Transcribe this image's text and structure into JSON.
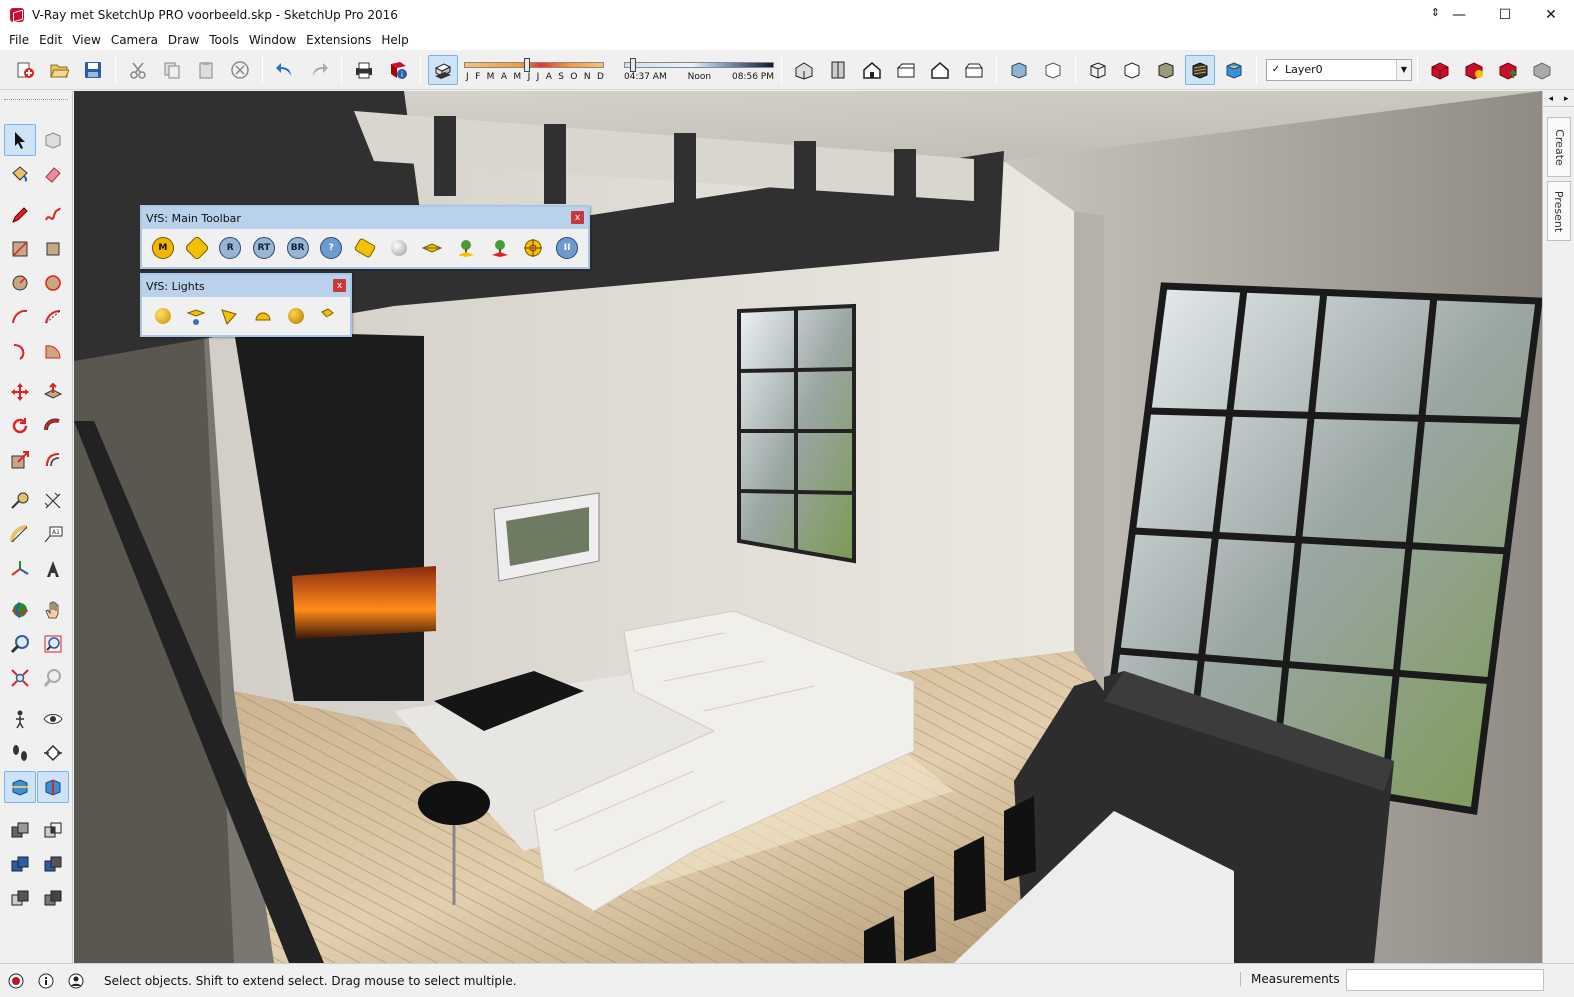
{
  "window": {
    "title": "V-Ray met SketchUp PRO voorbeeld.skp - SketchUp Pro 2016",
    "minimize": "—",
    "maximize": "☐",
    "close": "✕"
  },
  "menu": [
    "File",
    "Edit",
    "View",
    "Camera",
    "Draw",
    "Tools",
    "Window",
    "Extensions",
    "Help"
  ],
  "shadows": {
    "months": [
      "J",
      "F",
      "M",
      "A",
      "M",
      "J",
      "J",
      "A",
      "S",
      "O",
      "N",
      "D"
    ],
    "month_position": 0.44,
    "time_start": "04:37 AM",
    "time_mid": "Noon",
    "time_end": "08:56 PM",
    "time_position": 0.04
  },
  "layer": {
    "check": "✓",
    "current": "Layer0"
  },
  "float_main": {
    "title": "VfS: Main Toolbar",
    "close": "x",
    "buttons": [
      {
        "name": "vray-material-editor",
        "glyph": "M"
      },
      {
        "name": "vray-options",
        "glyph": ""
      },
      {
        "name": "vray-render",
        "glyph": "R"
      },
      {
        "name": "vray-render-rt",
        "glyph": "RT"
      },
      {
        "name": "vray-batch-render",
        "glyph": "BR"
      },
      {
        "name": "vray-help",
        "glyph": "?"
      },
      {
        "name": "vray-frame-buffer",
        "glyph": ""
      },
      {
        "name": "vray-sphere",
        "glyph": ""
      },
      {
        "name": "vray-infinite-plane",
        "glyph": ""
      },
      {
        "name": "vray-proxy-export",
        "glyph": ""
      },
      {
        "name": "vray-proxy-import",
        "glyph": ""
      },
      {
        "name": "vray-focus",
        "glyph": ""
      },
      {
        "name": "vray-pause",
        "glyph": "II"
      }
    ]
  },
  "float_lights": {
    "title": "VfS: Lights",
    "close": "x",
    "buttons": [
      "omni-light",
      "rectangle-light",
      "spot-light",
      "dome-light",
      "sphere-light",
      "ies-light"
    ]
  },
  "tray": {
    "tab_create": "Create",
    "tab_present": "Present",
    "arrow_left": "◂",
    "arrow_right": "▸"
  },
  "status": {
    "hint": "Select objects. Shift to extend select. Drag mouse to select multiple.",
    "measurements_label": "Measurements",
    "measurements_value": ""
  },
  "colors": {
    "accent": "#3a7bd5",
    "title_bar": "#ffffff",
    "float_header": "#b9d1ea",
    "sketchup_red": "#c8102e"
  }
}
